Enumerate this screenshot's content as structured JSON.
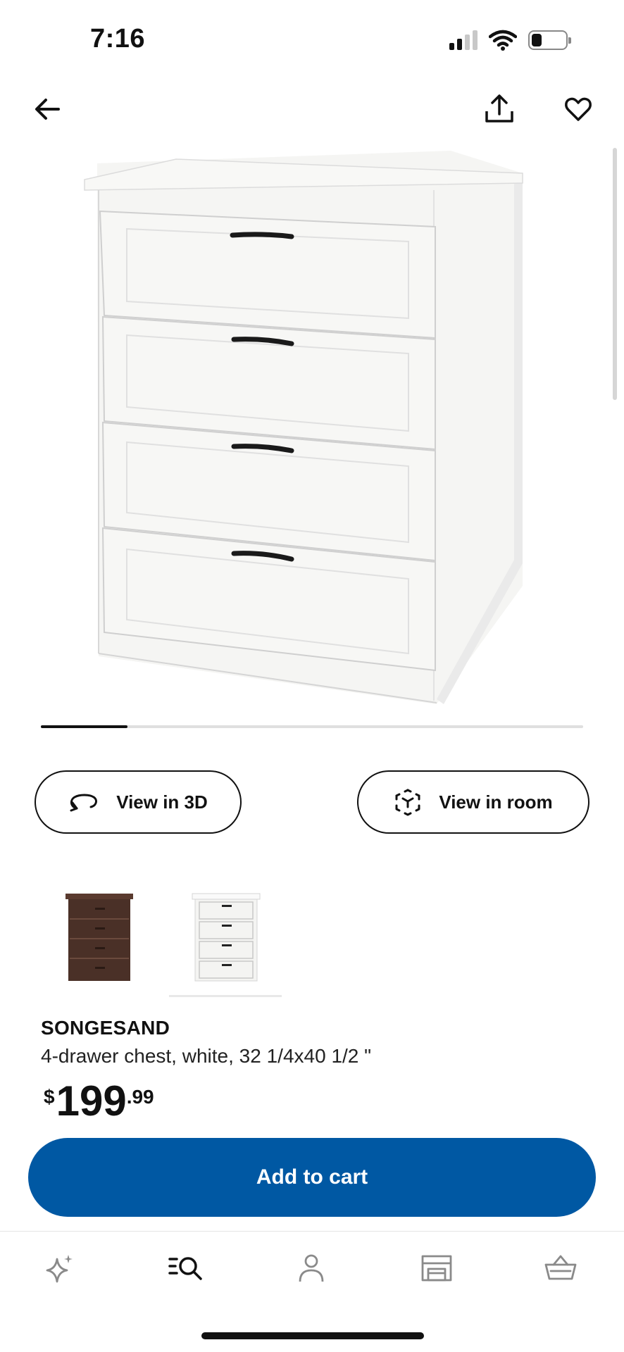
{
  "status_bar": {
    "time": "7:16"
  },
  "product": {
    "name": "SONGESAND",
    "description": "4-drawer chest, white, 32 1/4x40 1/2 \"",
    "price_currency": "$",
    "price_integer": "199",
    "price_decimal": ".99"
  },
  "gallery": {
    "progress": 0.16
  },
  "actions": {
    "view_3d_label": "View in 3D",
    "view_room_label": "View in room",
    "add_to_cart_label": "Add to cart"
  },
  "variants": [
    {
      "name": "brown",
      "color": "#4a3027",
      "selected": false
    },
    {
      "name": "white",
      "color": "#f4f4f2",
      "selected": true
    }
  ],
  "tabs": [
    "inspiration",
    "search",
    "profile",
    "store",
    "cart"
  ],
  "colors": {
    "brand_blue": "#0058a3",
    "text": "#111111"
  }
}
